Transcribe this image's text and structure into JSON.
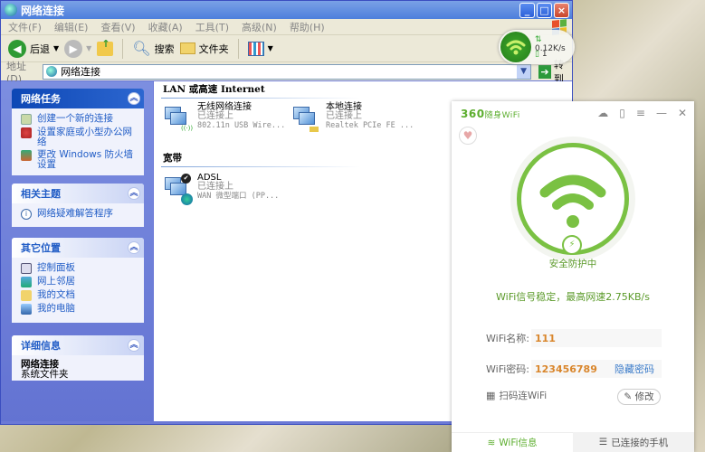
{
  "window": {
    "title": "网络连接",
    "controls": {
      "minimize": "_",
      "maximize": "□",
      "close": "×"
    }
  },
  "menu": [
    "文件(F)",
    "编辑(E)",
    "查看(V)",
    "收藏(A)",
    "工具(T)",
    "高级(N)",
    "帮助(H)"
  ],
  "toolbar": {
    "back": "后退",
    "search": "搜索",
    "folders": "文件夹"
  },
  "address": {
    "label": "地址(D)",
    "value": "网络连接",
    "go": "转到"
  },
  "sidebar": {
    "network_tasks": {
      "title": "网络任务",
      "items": [
        "创建一个新的连接",
        "设置家庭或小型办公网络",
        "更改 Windows 防火墙设置"
      ]
    },
    "related": {
      "title": "相关主题",
      "items": [
        "网络疑难解答程序"
      ]
    },
    "other_places": {
      "title": "其它位置",
      "items": [
        "控制面板",
        "网上邻居",
        "我的文档",
        "我的电脑"
      ]
    },
    "details": {
      "title": "详细信息",
      "name": "网络连接",
      "type": "系统文件夹"
    }
  },
  "groups": [
    {
      "title": "LAN 或高速 Internet",
      "items": [
        {
          "name": "无线网络连接",
          "status": "已连接上",
          "device": "802.11n USB Wire..."
        },
        {
          "name": "本地连接",
          "status": "已连接上",
          "device": "Realtek PCIe FE ..."
        }
      ]
    },
    {
      "title": "宽带",
      "items": [
        {
          "name": "ADSL",
          "status": "已连接上",
          "device": "WAN 微型端口 (PP..."
        }
      ]
    }
  ],
  "float_widget": {
    "speed": "0.12K/s",
    "devices": "1"
  },
  "wifi360": {
    "logo": "360",
    "logo_sub": "随身WiFi",
    "status": "安全防护中",
    "message": "WiFi信号稳定，最高网速2.75KB/s",
    "name_label": "WiFi名称:",
    "name_value": "111",
    "pass_label": "WiFi密码:",
    "pass_value": "123456789",
    "hide_password": "隐藏密码",
    "scan": "扫码连WiFi",
    "modify": "修改",
    "tabs": [
      "WiFi信息",
      "已连接的手机"
    ],
    "colors": {
      "accent": "#7ac143"
    }
  }
}
